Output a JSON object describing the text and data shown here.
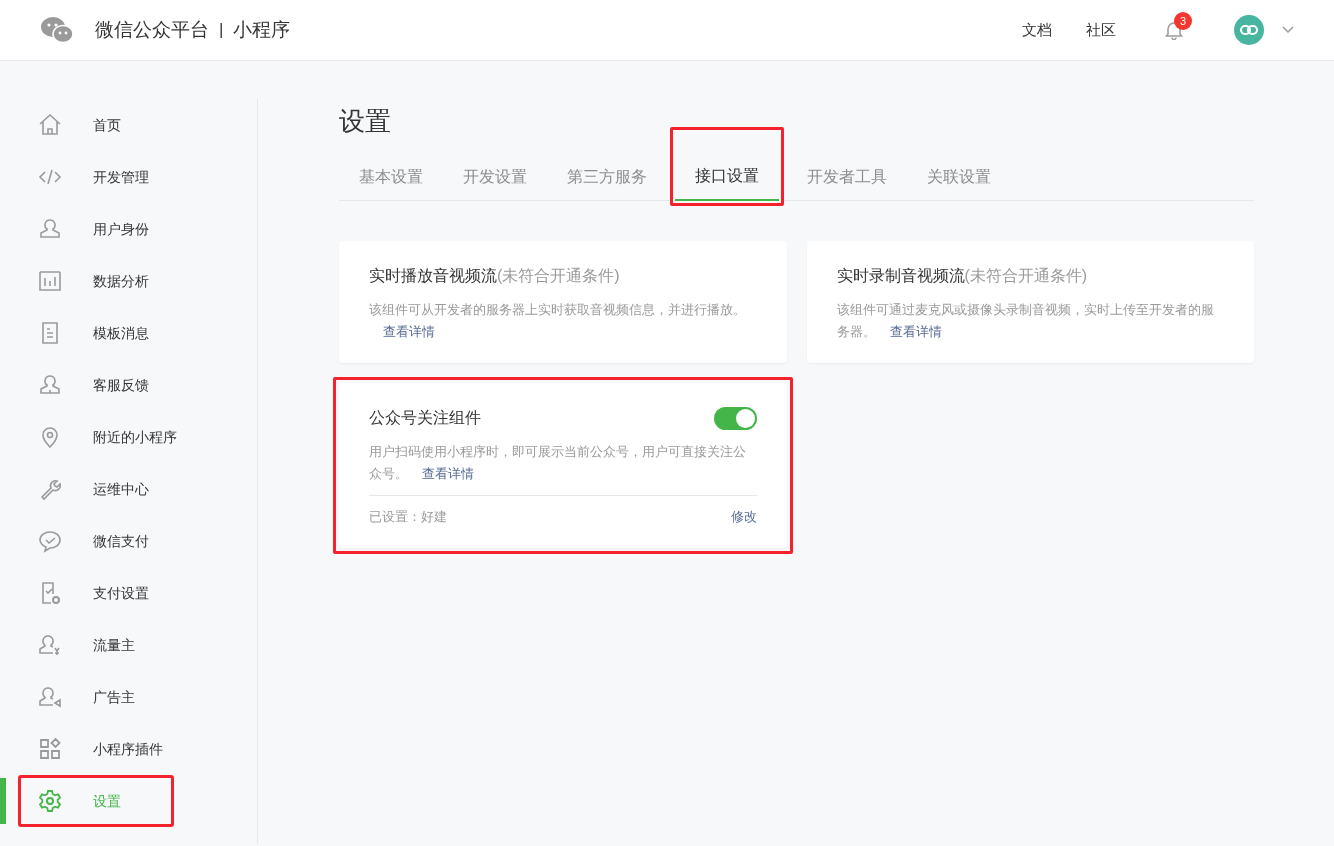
{
  "header": {
    "platform": "微信公众平台",
    "separator": "|",
    "product": "小程序",
    "links": [
      "文档",
      "社区"
    ],
    "notification_count": "3"
  },
  "sidebar": {
    "items": [
      {
        "label": "首页",
        "selected": false,
        "highlighted": false
      },
      {
        "label": "开发管理",
        "selected": false,
        "highlighted": false
      },
      {
        "label": "用户身份",
        "selected": false,
        "highlighted": false
      },
      {
        "label": "数据分析",
        "selected": false,
        "highlighted": false
      },
      {
        "label": "模板消息",
        "selected": false,
        "highlighted": false
      },
      {
        "label": "客服反馈",
        "selected": false,
        "highlighted": false
      },
      {
        "label": "附近的小程序",
        "selected": false,
        "highlighted": false
      },
      {
        "label": "运维中心",
        "selected": false,
        "highlighted": false
      },
      {
        "label": "微信支付",
        "selected": false,
        "highlighted": false
      },
      {
        "label": "支付设置",
        "selected": false,
        "highlighted": false
      },
      {
        "label": "流量主",
        "selected": false,
        "highlighted": false
      },
      {
        "label": "广告主",
        "selected": false,
        "highlighted": false
      },
      {
        "label": "小程序插件",
        "selected": false,
        "highlighted": false
      },
      {
        "label": "设置",
        "selected": true,
        "highlighted": true
      }
    ]
  },
  "page_title": "设置",
  "tabs": [
    {
      "label": "基本设置",
      "selected": false,
      "highlighted": false
    },
    {
      "label": "开发设置",
      "selected": false,
      "highlighted": false
    },
    {
      "label": "第三方服务",
      "selected": false,
      "highlighted": false
    },
    {
      "label": "接口设置",
      "selected": true,
      "highlighted": true
    },
    {
      "label": "开发者工具",
      "selected": false,
      "highlighted": false
    },
    {
      "label": "关联设置",
      "selected": false,
      "highlighted": false
    }
  ],
  "cards": [
    {
      "title": "实时播放音视频流",
      "title_note": "(未符合开通条件)",
      "description": "该组件可从开发者的服务器上实时获取音视频信息，并进行播放。",
      "link": "查看详情",
      "highlighted": false
    },
    {
      "title": "实时录制音视频流",
      "title_note": "(未符合开通条件)",
      "description": "该组件可通过麦克风或摄像头录制音视频，实时上传至开发者的服务器。",
      "link": "查看详情",
      "highlighted": false
    },
    {
      "title": "公众号关注组件",
      "description": "用户扫码使用小程序时，即可展示当前公众号，用户可直接关注公众号。",
      "link": "查看详情",
      "toggle": {
        "on": true
      },
      "footer": {
        "status": "已设置：好建",
        "action": "修改"
      },
      "highlighted": true
    }
  ]
}
